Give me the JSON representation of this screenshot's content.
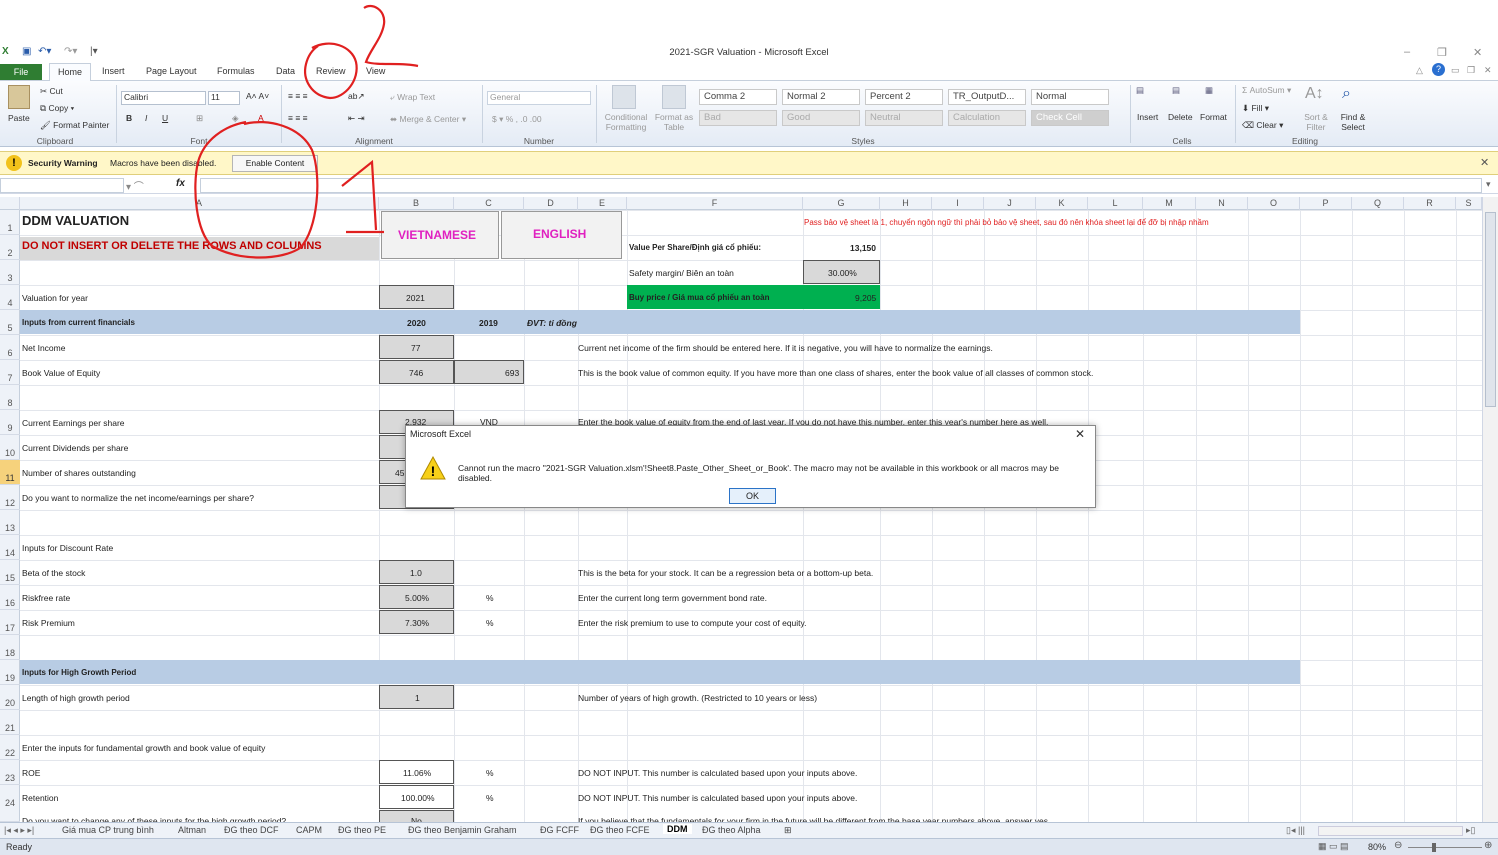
{
  "app_title": "2021-SGR Valuation  -  Microsoft Excel",
  "ribbon_tabs": [
    "File",
    "Home",
    "Insert",
    "Page Layout",
    "Formulas",
    "Data",
    "Review",
    "View"
  ],
  "clipboard": {
    "paste": "Paste",
    "cut": "Cut",
    "copy": "Copy",
    "format_painter": "Format Painter",
    "group": "Clipboard"
  },
  "font": {
    "name": "Calibri",
    "size": "11",
    "group": "Font"
  },
  "alignment": {
    "wrap_text": "Wrap Text",
    "merge_center": "Merge & Center",
    "group": "Alignment"
  },
  "number": {
    "format": "General",
    "group": "Number"
  },
  "styles": {
    "conditional": "Conditional Formatting",
    "format_table": "Format as Table",
    "row1": [
      "Comma 2",
      "Normal 2",
      "Percent 2",
      "TR_OutputD...",
      "Normal"
    ],
    "row2": [
      "Bad",
      "Good",
      "Neutral",
      "Calculation",
      "Check Cell"
    ],
    "group": "Styles"
  },
  "cells_group": {
    "insert": "Insert",
    "delete": "Delete",
    "format": "Format",
    "group": "Cells"
  },
  "editing": {
    "autosum": "AutoSum",
    "fill": "Fill",
    "clear": "Clear",
    "sort": "Sort & Filter",
    "find": "Find & Select",
    "group": "Editing"
  },
  "security": {
    "label": "Security Warning",
    "message": "Macros have been disabled.",
    "button": "Enable Content"
  },
  "columns": [
    "A",
    "B",
    "C",
    "D",
    "E",
    "F",
    "G",
    "H",
    "I",
    "J",
    "K",
    "L",
    "M",
    "N",
    "O",
    "P",
    "Q",
    "R",
    "S"
  ],
  "rows": [
    "1",
    "2",
    "3",
    "4",
    "5",
    "6",
    "7",
    "8",
    "9",
    "10",
    "11",
    "12",
    "13",
    "14",
    "15",
    "16",
    "17",
    "18",
    "19",
    "20",
    "21",
    "22",
    "23",
    "24"
  ],
  "sheet": {
    "title": "DDM VALUATION",
    "warning": "DO NOT INSERT OR DELETE THE ROWS AND COLUMNS",
    "btn_vn": "VIETNAMESE",
    "btn_en": "ENGLISH",
    "note_red": "Pass bảo vệ sheet là 1, chuyển ngôn ngữ thì phải bỏ bảo vệ sheet, sau đó nên khóa sheet lại để đỡ bị nhập nhầm",
    "value_per_share_label": "Value Per Share/Định giá cổ phiếu:",
    "value_per_share": "13,150",
    "safety_label": "Safety margin/ Biên an toàn",
    "safety": "30.00%",
    "buy_label": "Buy price / Giá mua cổ phiếu an toàn",
    "buy": "9,205",
    "val_year_label": "Valuation for year",
    "val_year": "2021",
    "inputs_fin": "Inputs from current financials",
    "y2020": "2020",
    "y2019": "2019",
    "unit": "ĐVT: tỉ đồng",
    "net_income_label": "Net Income",
    "net_income": "77",
    "net_income_note": "Current net income of the firm should be entered here. If it is negative, you will have to normalize the earnings.",
    "bve_label": "Book Value of Equity",
    "bve_2020": "746",
    "bve_2019": "693",
    "bve_note": "This is the book value of common equity. If you have more than one class of shares, enter the book value of all classes of common stock.",
    "eps_label": "Current Earnings per share",
    "eps": "2,932",
    "eps_unit": "VND",
    "eps_note": "Enter the book value of equity from the end of last year. If you do not have this number, enter this year's number here as well.",
    "dps_label": "Current Dividends per share",
    "shares_label": "Number of shares outstanding",
    "shares": "45,",
    "normalize_label": "Do you want to normalize the net income/earnings per share?",
    "discount_label": "Inputs for Discount Rate",
    "beta_label": "Beta of the stock",
    "beta": "1.0",
    "beta_note": "This is the beta for your stock. It can be a regression beta or a bottom-up beta.",
    "rf_label": "Riskfree rate",
    "rf": "5.00%",
    "pct": "%",
    "rf_note": "Enter the current long term government bond rate.",
    "rp_label": "Risk Premium",
    "rp": "7.30%",
    "rp_note": "Enter the risk premium to use to compute your cost of equity.",
    "hg_label": "Inputs for High Growth Period",
    "hg_len_label": "Length of high growth period",
    "hg_len": "1",
    "hg_len_note": "Number of years of high growth. (Restricted to 10 years or less)",
    "fund_label": "Enter the inputs for fundamental growth and book value of equity",
    "roe_label": "ROE",
    "roe": "11.06%",
    "roe_note": "DO NOT INPUT. This number is calculated based upon your inputs above.",
    "ret_label": "Retention",
    "ret": "100.00%",
    "ret_note": "DO NOT INPUT. This number is calculated based upon your inputs above.",
    "change_label": "Do you want to change any of these inputs for the high growth period?",
    "change": "No",
    "change_note": "If you believe that the fundamentals for your firm in the future will be different from the base year numbers above, answer yes."
  },
  "dialog": {
    "title": "Microsoft Excel",
    "message": "Cannot run the macro ''2021-SGR Valuation.xlsm'!Sheet8.Paste_Other_Sheet_or_Book'. The macro may not be available in this workbook or all macros may be disabled.",
    "ok": "OK"
  },
  "sheet_tabs": [
    "Giá mua CP trung bình",
    "Altman",
    "ĐG theo DCF",
    "CAPM",
    "ĐG theo PE",
    "ĐG theo Benjamin Graham",
    "ĐG FCFF",
    "ĐG theo FCFE",
    "DDM",
    "ĐG theo Alpha"
  ],
  "active_sheet": "DDM",
  "status": {
    "ready": "Ready",
    "zoom": "80%"
  },
  "colors": {
    "file_tab": "#2f7d32",
    "green_cell": "#00b050",
    "blue_row": "#b8cce4",
    "red_text": "#c00000",
    "magenta": "#e020c0",
    "annotation": "#e02020"
  }
}
